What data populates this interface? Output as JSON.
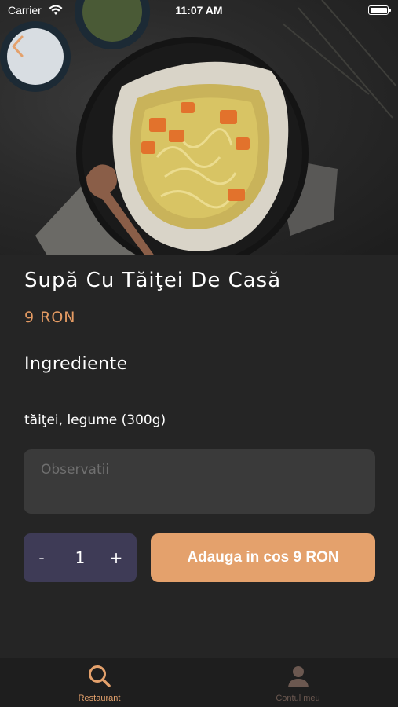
{
  "status_bar": {
    "carrier": "Carrier",
    "time": "11:07 AM"
  },
  "product": {
    "name": "Supă Cu Tăiţei De Casă",
    "price": "9 RON",
    "ingredients_heading": "Ingrediente",
    "ingredients": "tăiţei, legume (300g)"
  },
  "notes": {
    "placeholder": "Observatii",
    "value": ""
  },
  "quantity": {
    "minus_label": "-",
    "value": "1",
    "plus_label": "+"
  },
  "cart_button": {
    "label": "Adauga in cos 9 RON"
  },
  "tabs": [
    {
      "label": "Restaurant",
      "icon": "search-icon",
      "active": true
    },
    {
      "label": "Contul meu",
      "icon": "user-icon",
      "active": false
    }
  ],
  "colors": {
    "accent": "#e4a16c",
    "price": "#e59b63",
    "background": "#252525",
    "stepper": "#3e3b56",
    "field": "#3a3a3a"
  }
}
